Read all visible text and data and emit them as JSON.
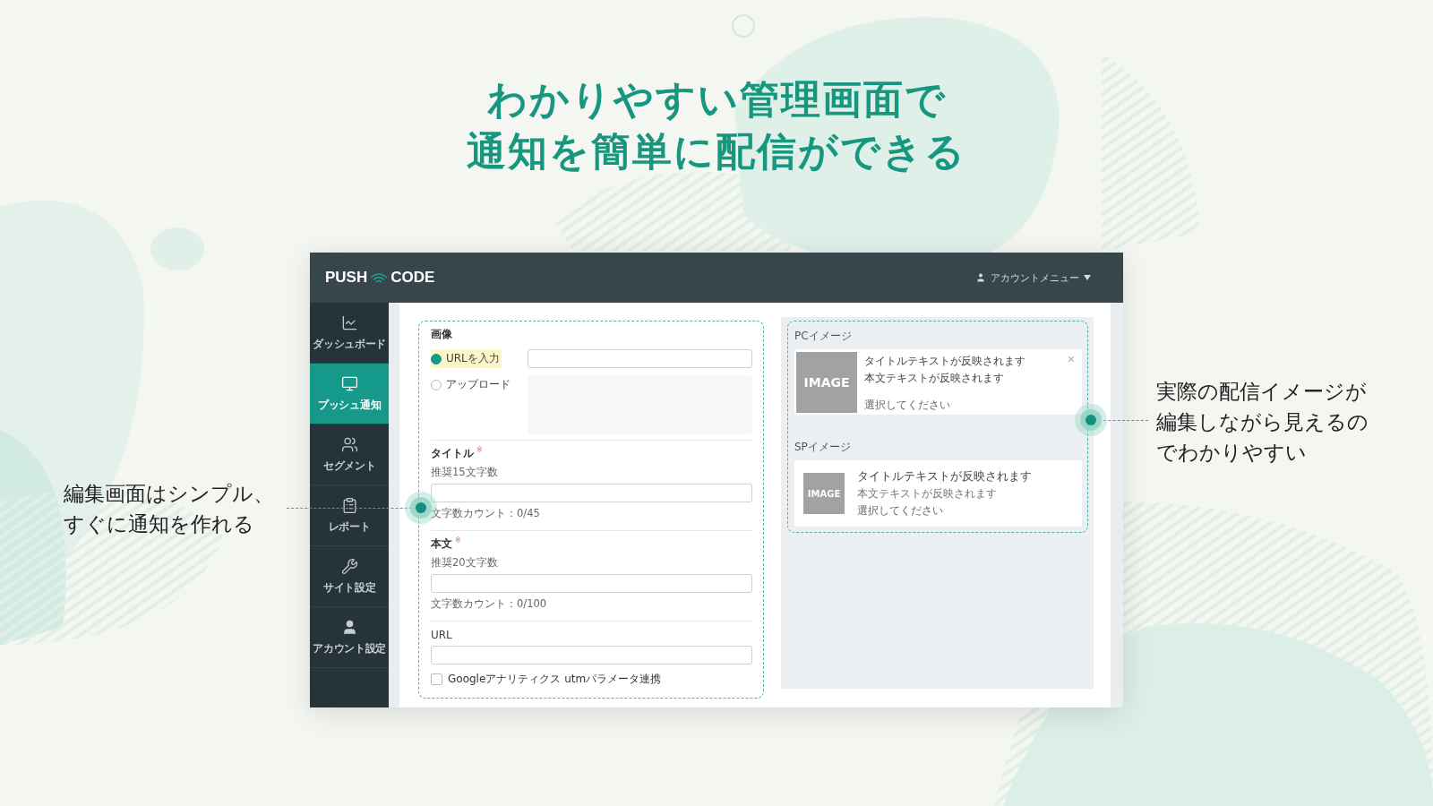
{
  "headline": [
    "わかりやすい管理画面で",
    "通知を簡単に配信ができる"
  ],
  "app": {
    "logo": {
      "first": "PUSH",
      "second": "CODE"
    },
    "account_menu": "アカウントメニュー",
    "sidebar": [
      {
        "label": "ダッシュボード",
        "selected": false
      },
      {
        "label": "プッシュ通知",
        "selected": true
      },
      {
        "label": "セグメント",
        "selected": false
      },
      {
        "label": "レポート",
        "selected": false
      },
      {
        "label": "サイト設定",
        "selected": false
      },
      {
        "label": "アカウント設定",
        "selected": false
      }
    ],
    "form": {
      "image_label": "画像",
      "image_options": [
        {
          "label": "URLを入力",
          "selected": true
        },
        {
          "label": "アップロード",
          "selected": false
        }
      ],
      "fields": [
        {
          "label": "タイトル",
          "required_mark": "※",
          "hint": "推奨15文字数",
          "counter": "文字数カウント：0/45"
        },
        {
          "label": "本文",
          "required_mark": "※",
          "hint": "推奨20文字数",
          "counter": "文字数カウント：0/100"
        },
        {
          "label": "URL"
        }
      ],
      "checkbox": {
        "label": "Googleアナリティクス utmパラメータ連携",
        "checked": false
      }
    },
    "preview": [
      {
        "kind": "pc",
        "label": "PCイメージ",
        "image": "IMAGE",
        "title": "タイトルテキストが反映されます",
        "body": "本文テキストが反映されます",
        "action": "選択してください",
        "close": "×"
      },
      {
        "kind": "sp",
        "label": "SPイメージ",
        "image": "IMAGE",
        "title": "タイトルテキストが反映されます",
        "body": "本文テキストが反映されます",
        "action": "選択してください"
      }
    ]
  },
  "annotations": [
    {
      "lines": [
        "編集画面はシンプル、",
        "すぐに通知を作れる"
      ]
    },
    {
      "lines": [
        "実際の配信イメージが",
        "編集しながら見えるの",
        "でわかりやすい"
      ]
    }
  ]
}
